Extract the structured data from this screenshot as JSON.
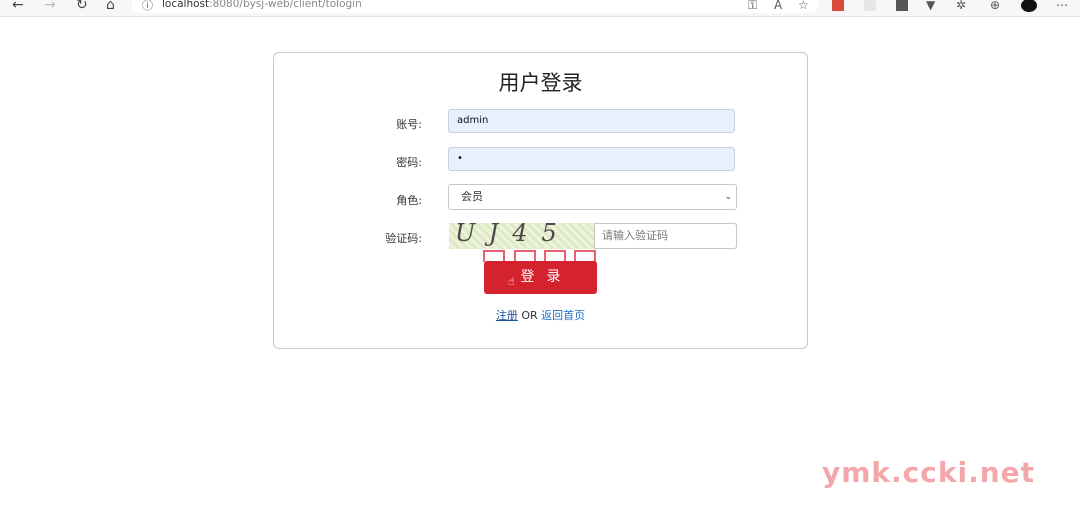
{
  "browser": {
    "url_host": "localhost",
    "url_rest": ":8080/bysj-web/client/tologin"
  },
  "login": {
    "title": "用户登录",
    "account_label": "账号:",
    "account_value": "admin",
    "password_label": "密码:",
    "password_value": "•",
    "role_label": "角色:",
    "role_selected": "会员",
    "captcha_label": "验证码:",
    "captcha_image_text": "UJ45",
    "captcha_placeholder": "请输入验证码",
    "login_button": "登录",
    "register_link": "注册",
    "or_text": "OR",
    "home_link": "返回首页"
  },
  "colors": {
    "accent": "#d5222f",
    "link": "#1e6fc7",
    "autofill_bg": "#e8f0fe"
  },
  "watermark": "ymk.ccki.net"
}
